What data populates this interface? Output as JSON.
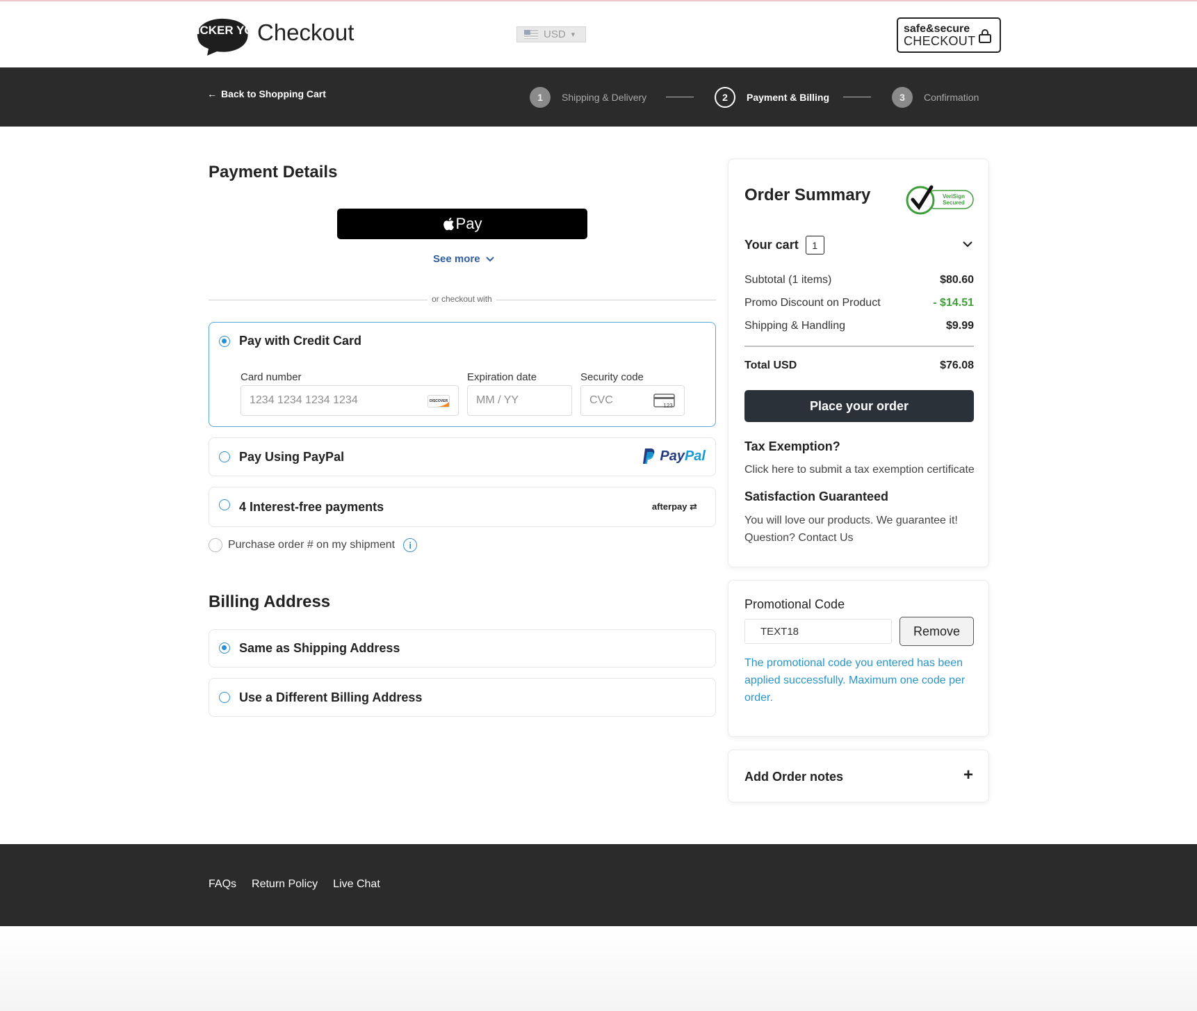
{
  "header": {
    "logo_text": "STICKER YOU",
    "title": "Checkout",
    "currency": "USD",
    "secure_line1": "safe&secure",
    "secure_line2": "CHECKOUT"
  },
  "nav": {
    "back_label": "Back to Shopping Cart",
    "steps": [
      {
        "num": "1",
        "label": "Shipping & Delivery",
        "state": "inactive"
      },
      {
        "num": "2",
        "label": "Payment & Billing",
        "state": "active"
      },
      {
        "num": "3",
        "label": "Confirmation",
        "state": "inactive"
      }
    ]
  },
  "payment": {
    "title": "Payment Details",
    "applepay_label": "Pay",
    "see_more": "See more",
    "or_checkout": "or checkout with",
    "credit_card": {
      "label": "Pay with Credit Card",
      "card_number_label": "Card number",
      "card_number_placeholder": "1234 1234 1234 1234",
      "card_brand": "DISCOVER",
      "expiry_label": "Expiration date",
      "expiry_placeholder": "MM / YY",
      "cvc_label": "Security code",
      "cvc_placeholder": "CVC",
      "cvc_icon_text": "123"
    },
    "paypal": {
      "label": "Pay Using PayPal",
      "brand_a": "Pay",
      "brand_b": "Pal"
    },
    "afterpay": {
      "label": "4 Interest-free payments",
      "brand": "afterpay"
    },
    "purchase_order": "Purchase order # on my shipment",
    "info_icon": "i"
  },
  "billing": {
    "title": "Billing Address",
    "same": "Same as Shipping Address",
    "different": "Use a Different Billing Address"
  },
  "summary": {
    "title": "Order Summary",
    "verisign_a": "VeriSign",
    "verisign_b": "Secured",
    "cart_label": "Your cart",
    "cart_count": "1",
    "subtotal_label": "Subtotal (1 items)",
    "subtotal_value": "$80.60",
    "promo_label": "Promo Discount on Product",
    "promo_value": "- $14.51",
    "shipping_label": "Shipping & Handling",
    "shipping_value": "$9.99",
    "total_label": "Total USD",
    "total_value": "$76.08",
    "place_order": "Place your order",
    "tax_title": "Tax Exemption?",
    "tax_text": "Click here to submit a tax exemption certificate",
    "sat_title": "Satisfaction Guaranteed",
    "sat_text": "You will love our products. We guarantee it!",
    "sat_contact": "Question? Contact Us"
  },
  "promo": {
    "title": "Promotional Code",
    "code": "TEXT18",
    "remove": "Remove",
    "message": "The promotional code you entered has been applied successfully. Maximum one code per order."
  },
  "notes": {
    "label": "Add Order notes",
    "plus": "+"
  },
  "footer": {
    "links": [
      "FAQs",
      "Return Policy",
      "Live Chat"
    ]
  },
  "colors": {
    "accent_blue": "#2a8fd0",
    "dark_bar": "#2b2b2b",
    "discount_green": "#3f9e3a",
    "promo_message": "#2b95c9"
  }
}
